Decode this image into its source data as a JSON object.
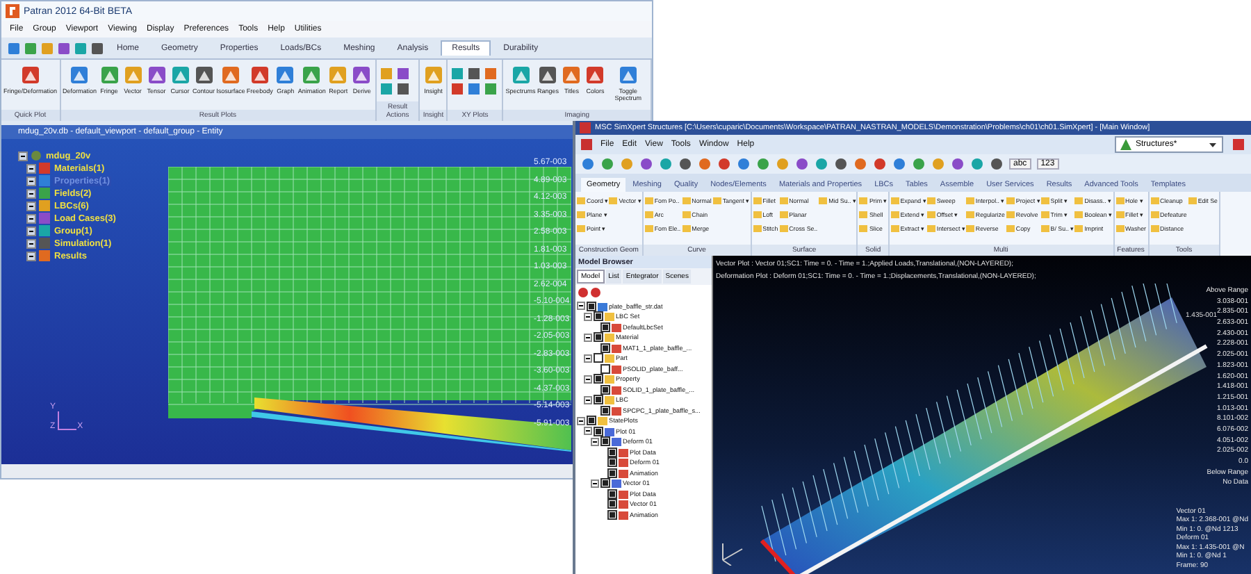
{
  "patran_window": {
    "title": "Patran 2012 64-Bit BETA",
    "menu": [
      "File",
      "Group",
      "Viewport",
      "Viewing",
      "Display",
      "Preferences",
      "Tools",
      "Help",
      "Utilities"
    ],
    "tabs": [
      {
        "label": "Home",
        "selected": false
      },
      {
        "label": "Geometry",
        "selected": false
      },
      {
        "label": "Properties",
        "selected": false
      },
      {
        "label": "Loads/BCs",
        "selected": false
      },
      {
        "label": "Meshing",
        "selected": false
      },
      {
        "label": "Analysis",
        "selected": false
      },
      {
        "label": "Results",
        "selected": true
      },
      {
        "label": "Durability",
        "selected": false
      }
    ],
    "ribbon_groups": [
      {
        "label": "Quick Plot",
        "kind": "large",
        "buttons": [
          "Fringe/Deformation"
        ]
      },
      {
        "label": "Result Plots",
        "kind": "large",
        "buttons": [
          "Deformation",
          "Fringe",
          "Vector",
          "Tensor",
          "Cursor",
          "Contour",
          "Isosurface",
          "Freebody",
          "Graph",
          "Animation",
          "Report",
          "Derive"
        ]
      },
      {
        "label": "Result Actions",
        "kind": "grid4"
      },
      {
        "label": "Insight",
        "kind": "large",
        "buttons": [
          "Insight"
        ]
      },
      {
        "label": "XY Plots",
        "kind": "grid6"
      },
      {
        "label": "Imaging",
        "kind": "large",
        "buttons": [
          "Spectrums",
          "Ranges",
          "Titles",
          "Colors",
          "Toggle Spectrum"
        ]
      }
    ],
    "viewport": {
      "title": "mdug_20v.db - default_viewport - default_group - Entity",
      "tree": {
        "label": "mdug_20v",
        "children": [
          {
            "label": "Materials(1)",
            "selected": false
          },
          {
            "label": "Properties(1)",
            "selected": true
          },
          {
            "label": "Fields(2)",
            "selected": false
          },
          {
            "label": "LBCs(6)",
            "selected": false
          },
          {
            "label": "Load Cases(3)",
            "selected": false
          },
          {
            "label": "Group(1)",
            "selected": false
          },
          {
            "label": "Simulation(1)",
            "selected": false
          },
          {
            "label": "Results",
            "selected": false
          }
        ]
      },
      "legend": [
        "5.67-003",
        "4.89-003",
        "4.12-003",
        "3.35-003",
        "2.58-003",
        "1.81-003",
        "1.03-003",
        "2.62-004",
        "-5.10-004",
        "-1.28-003",
        "-2.05-003",
        "-2.83-003",
        "-3.60-003",
        "-4.37-003",
        "-5.14-003",
        "-5.91-003"
      ],
      "axis_labels": [
        "Y",
        "Z",
        "X"
      ]
    }
  },
  "simxpert_window": {
    "title": "MSC SimXpert Structures [C:\\Users\\cuparic\\Documents\\Workspace\\PATRAN_NASTRAN_MODELS\\Demonstration\\Problems\\ch01\\ch01.SimXpert] - [Main Window]",
    "menu": [
      "File",
      "Edit",
      "View",
      "Tools",
      "Window",
      "Help"
    ],
    "workspace": "Structures*",
    "toolbar_texts": [
      "abc",
      "123"
    ],
    "tabs": [
      {
        "label": "Geometry",
        "selected": true
      },
      {
        "label": "Meshing",
        "selected": false
      },
      {
        "label": "Quality",
        "selected": false
      },
      {
        "label": "Nodes/Elements",
        "selected": false
      },
      {
        "label": "Materials and Properties",
        "selected": false
      },
      {
        "label": "LBCs",
        "selected": false
      },
      {
        "label": "Tables",
        "selected": false
      },
      {
        "label": "Assemble",
        "selected": false
      },
      {
        "label": "User Services",
        "selected": false
      },
      {
        "label": "Results",
        "selected": false
      },
      {
        "label": "Advanced Tools",
        "selected": false
      },
      {
        "label": "Templates",
        "selected": false
      }
    ],
    "ribbon_groups": [
      {
        "label": "Construction Geom",
        "buttons": [
          "Coord ▾",
          "Plane ▾",
          "Point ▾",
          "Vector ▾"
        ]
      },
      {
        "label": "Curve",
        "buttons": [
          "Fom Po..",
          "Arc",
          "Fom Ele..",
          "Normal",
          "Chain",
          "Merge",
          "Tangent ▾"
        ]
      },
      {
        "label": "Surface",
        "buttons": [
          "Fillet",
          "Loft",
          "Stitch",
          "Normal",
          "Planar",
          "Cross Se..",
          "Mid Su.. ▾"
        ]
      },
      {
        "label": "Solid",
        "buttons": [
          "Prim ▾",
          "Shell",
          "Slice"
        ]
      },
      {
        "label": "Multi",
        "buttons": [
          "Expand ▾",
          "Extend ▾",
          "Extract ▾",
          "Sweep",
          "Offset ▾",
          "Intersect ▾",
          "Interpol.. ▾",
          "Regularize",
          "Reverse",
          "Project ▾",
          "Revolve",
          "Copy",
          "Split ▾",
          "Trim ▾",
          "B/ Su.. ▾",
          "Disass.. ▾",
          "Boolean ▾",
          "Imprint"
        ]
      },
      {
        "label": "Features",
        "buttons": [
          "Hole ▾",
          "Fillet ▾",
          "Washer"
        ]
      },
      {
        "label": "Tools",
        "buttons": [
          "Cleanup",
          "Defeature",
          "Distance",
          "Edit Se"
        ]
      }
    ],
    "model_browser": {
      "title": "Model Browser",
      "tabs": [
        {
          "label": "Model",
          "selected": true
        },
        {
          "label": "List",
          "selected": false
        },
        {
          "label": "Entegrator",
          "selected": false
        },
        {
          "label": "Scenes",
          "selected": false
        }
      ],
      "tree": [
        {
          "label": "plate_baffle_str.dat",
          "kind": "file",
          "checked": true,
          "children": [
            {
              "label": "LBC Set",
              "kind": "folder",
              "checked": true,
              "children": [
                {
                  "label": "DefaultLbcSet",
                  "kind": "entity",
                  "checked": true
                }
              ]
            },
            {
              "label": "Material",
              "kind": "folder",
              "checked": true,
              "children": [
                {
                  "label": "MAT1_1_plate_baffle_...",
                  "kind": "entity",
                  "checked": true
                }
              ]
            },
            {
              "label": "Part",
              "kind": "folder",
              "checked": false,
              "children": [
                {
                  "label": "PSOLID_plate_baff...",
                  "kind": "entity",
                  "checked": false
                }
              ]
            },
            {
              "label": "Property",
              "kind": "folder",
              "checked": true,
              "children": [
                {
                  "label": "SOLID_1_plate_baffle_...",
                  "kind": "entity",
                  "checked": true
                }
              ]
            },
            {
              "label": "LBC",
              "kind": "folder",
              "checked": true,
              "children": [
                {
                  "label": "SPCPC_1_plate_baffle_s...",
                  "kind": "entity",
                  "checked": true
                }
              ]
            }
          ]
        },
        {
          "label": "StatePlots",
          "kind": "folder",
          "checked": true,
          "children": [
            {
              "label": "Plot 01",
              "kind": "plot",
              "checked": true,
              "children": [
                {
                  "label": "Deform 01",
                  "kind": "plot",
                  "checked": true,
                  "children": [
                    {
                      "label": "Plot Data",
                      "kind": "entity",
                      "checked": true
                    },
                    {
                      "label": "Deform 01",
                      "kind": "entity",
                      "checked": true
                    },
                    {
                      "label": "Animation",
                      "kind": "entity",
                      "checked": true
                    }
                  ]
                },
                {
                  "label": "Vector 01",
                  "kind": "plot",
                  "checked": true,
                  "children": [
                    {
                      "label": "Plot Data",
                      "kind": "entity",
                      "checked": true
                    },
                    {
                      "label": "Vector 01",
                      "kind": "entity",
                      "checked": true
                    },
                    {
                      "label": "Animation",
                      "kind": "entity",
                      "checked": true
                    }
                  ]
                }
              ]
            }
          ]
        }
      ]
    },
    "viewport": {
      "captions": [
        "Vector Plot : Vector 01;SC1: Time = 0. - Time = 1.;Applied Loads,Translational,(NON-LAYERED);",
        "Deformation Plot : Deform 01;SC1: Time = 0. - Time = 1.;Displacements,Translational,(NON-LAYERED);"
      ],
      "max_label": "1.435-001",
      "legend": [
        "Above Range",
        "3.038-001",
        "2.835-001",
        "2.633-001",
        "2.430-001",
        "2.228-001",
        "2.025-001",
        "1.823-001",
        "1.620-001",
        "1.418-001",
        "1.215-001",
        "1.013-001",
        "8.101-002",
        "6.076-002",
        "4.051-002",
        "2.025-002",
        "0.0",
        "Below Range",
        "No Data"
      ],
      "stats": [
        "Vector 01",
        "Max 1: 2.368-001 @Nd",
        "Min 1:  0. @Nd 1213",
        "Deform 01",
        "Max 1: 1.435-001 @N",
        "Min 1:  0. @Nd 1",
        "Frame:  90"
      ]
    }
  }
}
